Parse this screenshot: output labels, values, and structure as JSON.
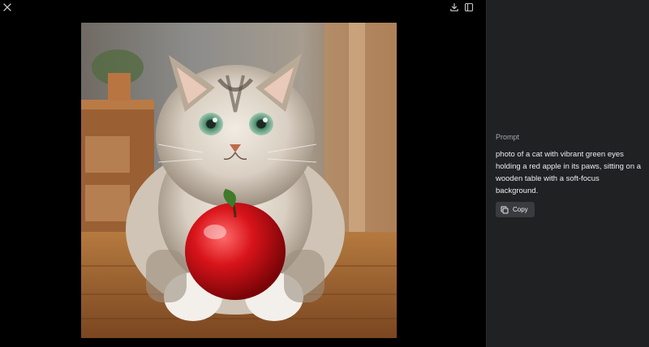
{
  "viewer": {
    "icons": {
      "close": "close-icon",
      "download": "download-icon",
      "sidebar_toggle": "sidebar-panel-icon"
    },
    "image": {
      "kind": "generated-image"
    }
  },
  "panel": {
    "prompt_label": "Prompt",
    "prompt_text": "photo of a cat with vibrant green eyes holding a red apple in its paws, sitting on a wooden table with a soft-focus background.",
    "copy_label": "Copy",
    "copy_icon": "copy-icon"
  },
  "colors": {
    "viewer_bg": "#000000",
    "panel_bg": "#202123",
    "button_bg": "#3a3b3f",
    "text_primary": "#ececf1",
    "text_secondary": "#a8a8ad"
  }
}
